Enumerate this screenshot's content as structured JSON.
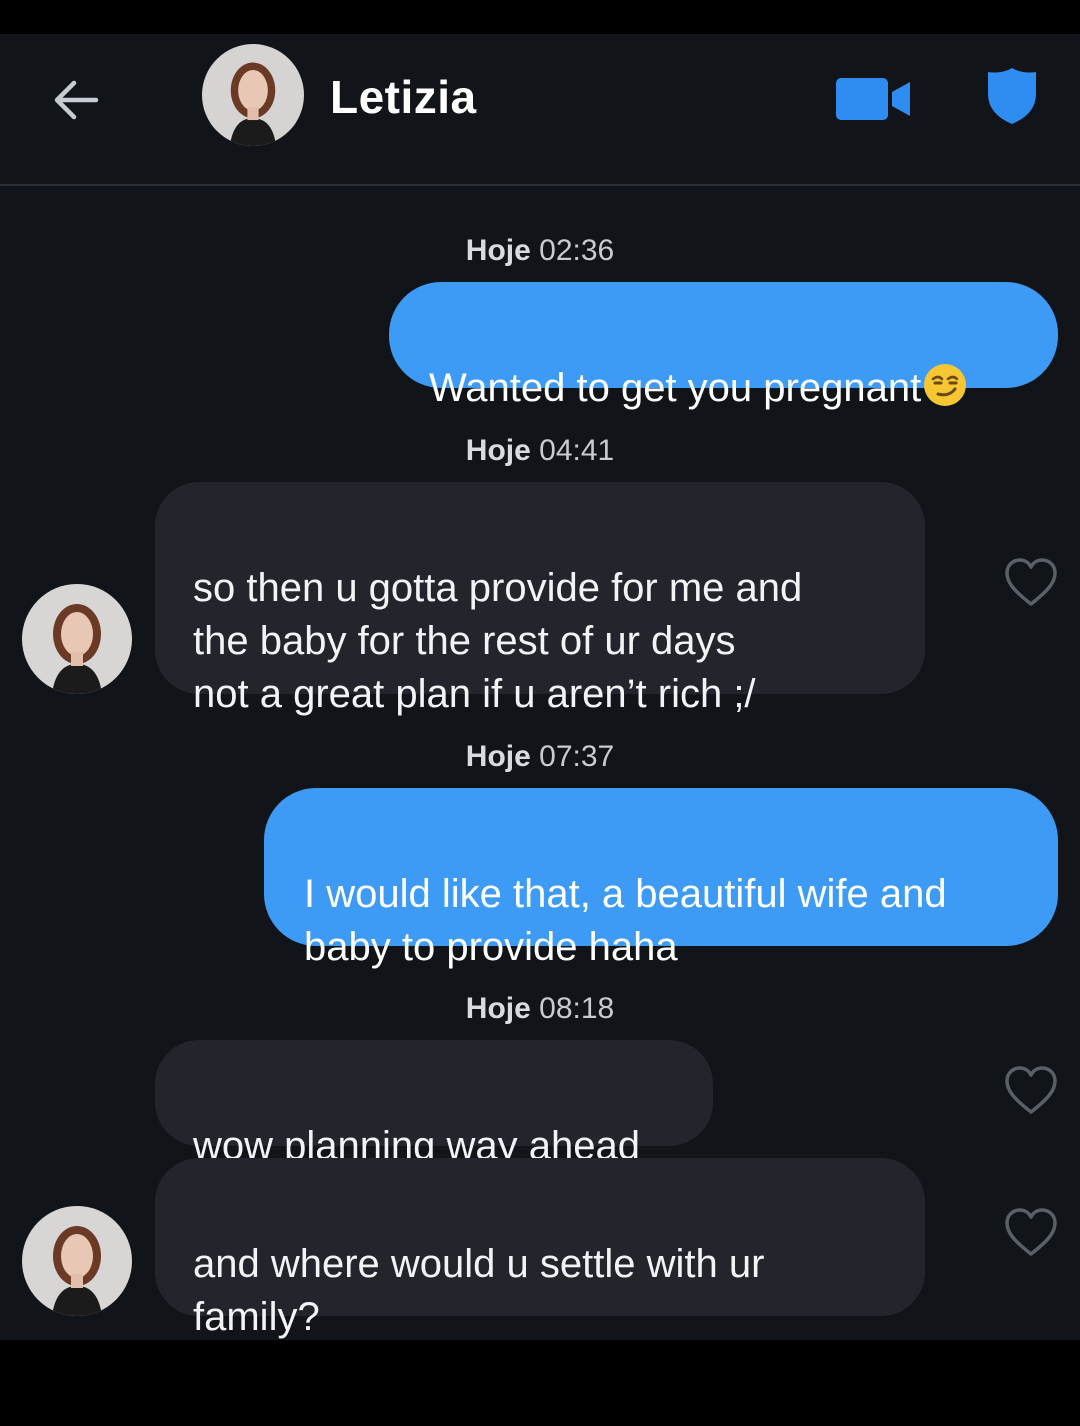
{
  "header": {
    "back_icon": "arrow-left-icon",
    "contact_name": "Letizia",
    "video_icon": "video-camera-icon",
    "shield_icon": "shield-icon",
    "accent_color": "#2f8cf0"
  },
  "messages": [
    {
      "timestamp_day": "Hoje",
      "timestamp_time": "02:36"
    },
    {
      "direction": "sent",
      "text": "Wanted to get you pregnant",
      "emoji": "smirking-face-emoji"
    },
    {
      "timestamp_day": "Hoje",
      "timestamp_time": "04:41"
    },
    {
      "direction": "received",
      "text": "so then u gotta provide for me and\nthe baby for the rest of ur days\nnot a great plan if u aren’t rich ;/"
    },
    {
      "timestamp_day": "Hoje",
      "timestamp_time": "07:37"
    },
    {
      "direction": "sent",
      "text": "I would like that, a beautiful wife and\nbaby to provide haha"
    },
    {
      "timestamp_day": "Hoje",
      "timestamp_time": "08:18"
    },
    {
      "direction": "received",
      "text": "wow planning way ahead"
    },
    {
      "direction": "received",
      "text": "and where would u settle with ur\nfamily?"
    }
  ],
  "colors": {
    "background": "#111418",
    "sent_bubble": "#3d9bf5",
    "received_bubble": "#22262c",
    "heart_outline": "#5b6068"
  }
}
